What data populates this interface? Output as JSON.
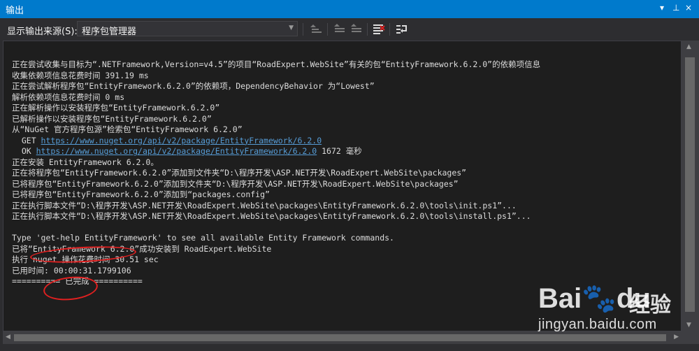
{
  "window": {
    "title": "输出",
    "controls": [
      "▾",
      "⊥",
      "×"
    ]
  },
  "toolbar": {
    "source_label": "显示输出来源(S):",
    "source_value": "程序包管理器",
    "buttons": [
      "go-to-previous-message-icon",
      "go-to-next-message-icon",
      "find-message-icon",
      "clear-all-icon",
      "toggle-word-wrap-icon"
    ]
  },
  "output": {
    "lines": [
      "正在尝试收集与目标为“.NETFramework,Version=v4.5”的项目“RoadExpert.WebSite”有关的包“EntityFramework.6.2.0”的依赖项信息",
      "收集依赖项信息花费时间 391.19 ms",
      "正在尝试解析程序包“EntityFramework.6.2.0”的依赖项，DependencyBehavior 为“Lowest”",
      "解析依赖项信息花费时间 0 ms",
      "正在解析操作以安装程序包“EntityFramework.6.2.0”",
      "已解析操作以安装程序包“EntityFramework.6.2.0”",
      "从“NuGet 官方程序包源”检索包“EntityFramework 6.2.0”",
      "  GET ",
      "  OK ",
      "正在安装 EntityFramework 6.2.0。",
      "正在将程序包“EntityFramework.6.2.0”添加到文件夹“D:\\程序开发\\ASP.NET开发\\RoadExpert.WebSite\\packages”",
      "已将程序包“EntityFramework.6.2.0”添加到文件夹“D:\\程序开发\\ASP.NET开发\\RoadExpert.WebSite\\packages”",
      "已将程序包“EntityFramework.6.2.0”添加到“packages.config”",
      "正在执行脚本文件“D:\\程序开发\\ASP.NET开发\\RoadExpert.WebSite\\packages\\EntityFramework.6.2.0\\tools\\init.ps1”...",
      "正在执行脚本文件“D:\\程序开发\\ASP.NET开发\\RoadExpert.WebSite\\packages\\EntityFramework.6.2.0\\tools\\install.ps1”...",
      "",
      "Type 'get-help EntityFramework' to see all available Entity Framework commands.",
      "已将“EntityFramework 6.2.0”成功安装到 RoadExpert.WebSite",
      "执行 nuget 操作花费时间 30.51 sec",
      "已用时间: 00:00:31.1799106",
      "========== 已完成 =========="
    ],
    "get_url": "https://www.nuget.org/api/v2/package/EntityFramework/6.2.0",
    "ok_url": "https://www.nuget.org/api/v2/package/EntityFramework/6.2.0",
    "ok_suffix": " 1672 毫秒"
  },
  "watermark": {
    "brand": "Bai🐾du",
    "cn": "经验",
    "url": "jingyan.baidu.com"
  },
  "colors": {
    "accent": "#007acc",
    "annotation": "#e02020",
    "link": "#569cd6"
  }
}
